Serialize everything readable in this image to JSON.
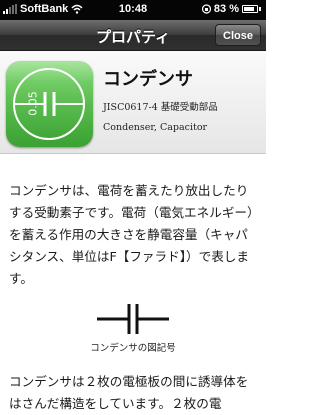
{
  "status_bar": {
    "carrier": "SoftBank",
    "time": "10:48",
    "battery_level": "83 %",
    "battery_fraction": 0.83
  },
  "nav": {
    "title": "プロパティ",
    "close_label": "Close"
  },
  "component": {
    "title": "コンデンサ",
    "code": "JISC0617-4 基礎受動部品",
    "english": "Condenser, Capacitor",
    "icon_value": "0.05"
  },
  "body": {
    "paragraph_1": "コンデンサは、電荷を蓄えたり放出したりする受動素子です。電荷（電気エネルギー）を蓄える作用の大きさを静電容量（キャパシタンス、単位はF【ファラド】）で表します。",
    "symbol_caption": "コンデンサの図記号",
    "paragraph_2": "コンデンサは２枚の電極板の間に誘導体をはさんだ構造をしています。２枚の電"
  },
  "icons": {
    "signal": "signal-bars-icon",
    "wifi": "wifi-icon",
    "lock": "rotation-lock-icon",
    "battery": "battery-icon",
    "app": "capacitor-app-icon",
    "symbol": "capacitor-symbol-icon"
  },
  "colors": {
    "status_bar": "#050505",
    "nav_bar": "#3c3c3c",
    "icon_green": "#4cb63f",
    "header_bg": "#efefef"
  }
}
